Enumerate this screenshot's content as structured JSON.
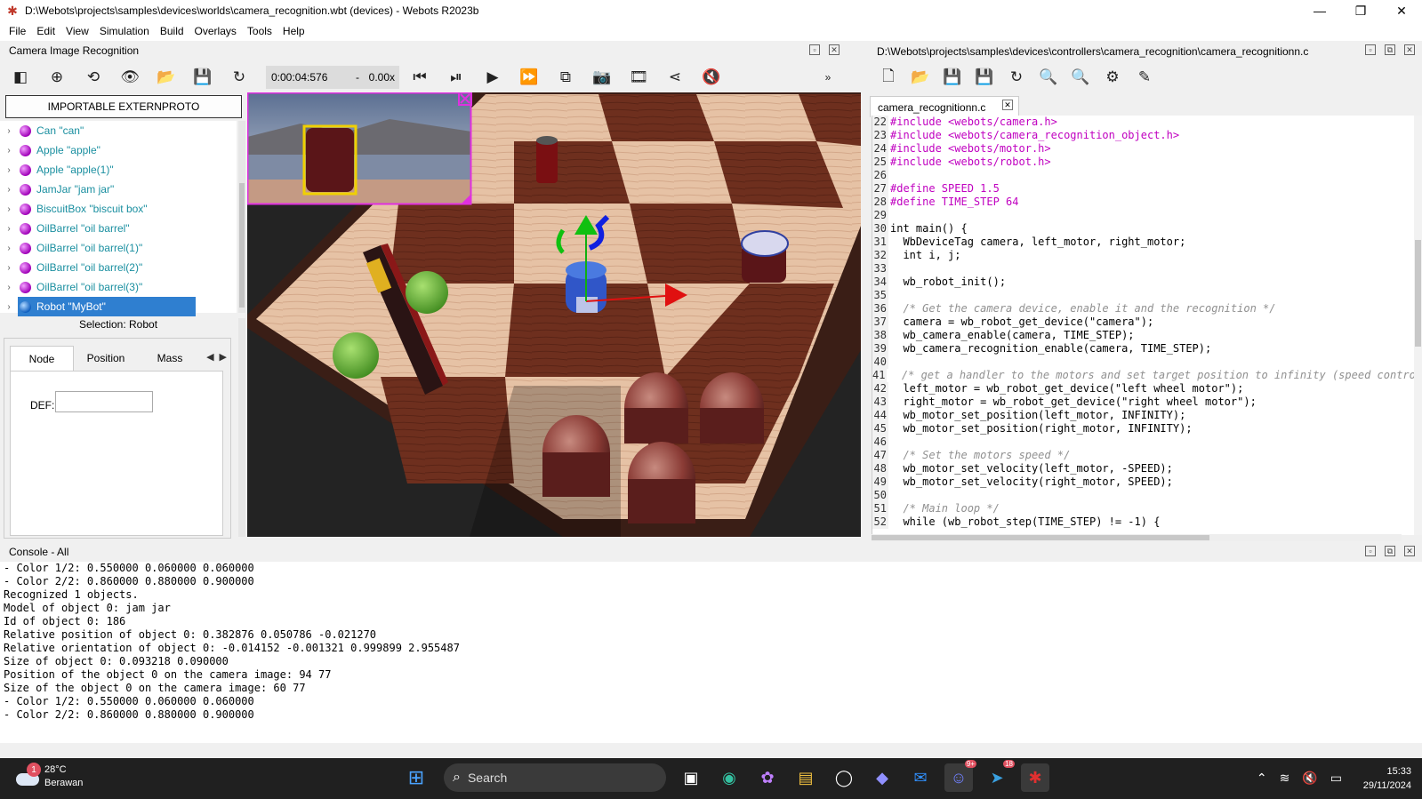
{
  "window": {
    "title": "D:\\Webots\\projects\\samples\\devices\\worlds\\camera_recognition.wbt (devices) - Webots R2023b"
  },
  "menu": [
    "File",
    "Edit",
    "View",
    "Simulation",
    "Build",
    "Overlays",
    "Tools",
    "Help"
  ],
  "scene_panel": {
    "title": "Camera Image Recognition",
    "extproto_button": "IMPORTABLE EXTERNPROTO",
    "tree": [
      {
        "label": "Can \"can\""
      },
      {
        "label": "Apple \"apple\""
      },
      {
        "label": "Apple \"apple(1)\""
      },
      {
        "label": "JamJar \"jam jar\""
      },
      {
        "label": "BiscuitBox \"biscuit box\""
      },
      {
        "label": "OilBarrel \"oil barrel\""
      },
      {
        "label": "OilBarrel \"oil barrel(1)\""
      },
      {
        "label": "OilBarrel \"oil barrel(2)\""
      },
      {
        "label": "OilBarrel \"oil barrel(3)\""
      },
      {
        "label": "Robot \"MyBot\"",
        "selected": true
      }
    ],
    "selection_label": "Selection: Robot",
    "tabs": [
      "Node",
      "Position",
      "Mass"
    ],
    "def_label": "DEF:",
    "def_value": ""
  },
  "toolbar": {
    "time": "0:00:04:576",
    "separator": "-",
    "speed": "0.00x"
  },
  "editor": {
    "path": "D:\\Webots\\projects\\samples\\devices\\controllers\\camera_recognition\\camera_recognitionn.c",
    "tab_label": "camera_recognitionn.c",
    "lines": [
      {
        "n": "22",
        "text": "#include <webots/camera.h>"
      },
      {
        "n": "23",
        "text": "#include <webots/camera_recognition_object.h>"
      },
      {
        "n": "24",
        "text": "#include <webots/motor.h>"
      },
      {
        "n": "25",
        "text": "#include <webots/robot.h>"
      },
      {
        "n": "26",
        "text": ""
      },
      {
        "n": "27",
        "text": "#define SPEED 1.5"
      },
      {
        "n": "28",
        "text": "#define TIME_STEP 64"
      },
      {
        "n": "29",
        "text": ""
      },
      {
        "n": "30",
        "text": "int main() {"
      },
      {
        "n": "31",
        "text": "  WbDeviceTag camera, left_motor, right_motor;"
      },
      {
        "n": "32",
        "text": "  int i, j;"
      },
      {
        "n": "33",
        "text": ""
      },
      {
        "n": "34",
        "text": "  wb_robot_init();"
      },
      {
        "n": "35",
        "text": ""
      },
      {
        "n": "36",
        "text": "  /* Get the camera device, enable it and the recognition */"
      },
      {
        "n": "37",
        "text": "  camera = wb_robot_get_device(\"camera\");"
      },
      {
        "n": "38",
        "text": "  wb_camera_enable(camera, TIME_STEP);"
      },
      {
        "n": "39",
        "text": "  wb_camera_recognition_enable(camera, TIME_STEP);"
      },
      {
        "n": "40",
        "text": ""
      },
      {
        "n": "41",
        "text": "  /* get a handler to the motors and set target position to infinity (speed control"
      },
      {
        "n": "42",
        "text": "  left_motor = wb_robot_get_device(\"left wheel motor\");"
      },
      {
        "n": "43",
        "text": "  right_motor = wb_robot_get_device(\"right wheel motor\");"
      },
      {
        "n": "44",
        "text": "  wb_motor_set_position(left_motor, INFINITY);"
      },
      {
        "n": "45",
        "text": "  wb_motor_set_position(right_motor, INFINITY);"
      },
      {
        "n": "46",
        "text": ""
      },
      {
        "n": "47",
        "text": "  /* Set the motors speed */"
      },
      {
        "n": "48",
        "text": "  wb_motor_set_velocity(left_motor, -SPEED);"
      },
      {
        "n": "49",
        "text": "  wb_motor_set_velocity(right_motor, SPEED);"
      },
      {
        "n": "50",
        "text": ""
      },
      {
        "n": "51",
        "text": "  /* Main loop */"
      },
      {
        "n": "52",
        "text": "  while (wb_robot_step(TIME_STEP) != -1) {"
      }
    ]
  },
  "console": {
    "title": "Console - All",
    "lines": [
      "- Color 1/2: 0.550000 0.060000 0.060000",
      "- Color 2/2: 0.860000 0.880000 0.900000",
      "Recognized 1 objects.",
      "Model of object 0: jam jar",
      "Id of object 0: 186",
      "Relative position of object 0: 0.382876 0.050786 -0.021270",
      "Relative orientation of object 0: -0.014152 -0.001321 0.999899 2.955487",
      "Size of object 0: 0.093218 0.090000",
      "Position of the object 0 on the camera image: 94 77",
      "Size of the object 0 on the camera image: 60 77",
      "- Color 1/2: 0.550000 0.060000 0.060000",
      "- Color 2/2: 0.860000 0.880000 0.900000"
    ]
  },
  "taskbar": {
    "weather_badge": "1",
    "temperature": "28°C",
    "condition": "Berawan",
    "search_label": "Search",
    "discord_badge": "9+",
    "telegram_badge": "18",
    "time": "15:33",
    "date": "29/11/2024"
  }
}
